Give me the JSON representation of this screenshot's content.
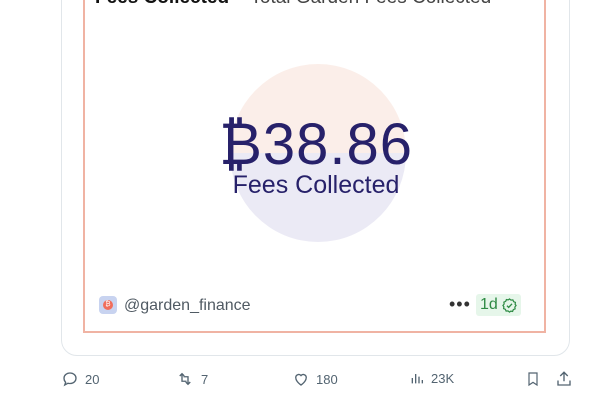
{
  "card": {
    "header_title": "Fees Collected",
    "header_subtitle": "Total Garden Fees Collected",
    "amount": "₿38.86",
    "amount_label": "Fees Collected",
    "handle": "@garden_finance",
    "more": "•••",
    "age": "1d",
    "colors": {
      "frame_border": "#f0b3a3",
      "amount_text": "#27216a",
      "circle_top": "#fbeee9",
      "circle_bottom": "#ebeaf5",
      "badge_bg": "#e6f6ea",
      "badge_text": "#2e8b44"
    }
  },
  "actions": {
    "reply_count": "20",
    "repost_count": "7",
    "like_count": "180",
    "views_count": "23K"
  },
  "icons": {
    "reply": "reply-icon",
    "repost": "repost-icon",
    "like": "heart-icon",
    "views": "views-icon",
    "bookmark": "bookmark-icon",
    "share": "share-icon",
    "verified": "verified-check-icon"
  }
}
